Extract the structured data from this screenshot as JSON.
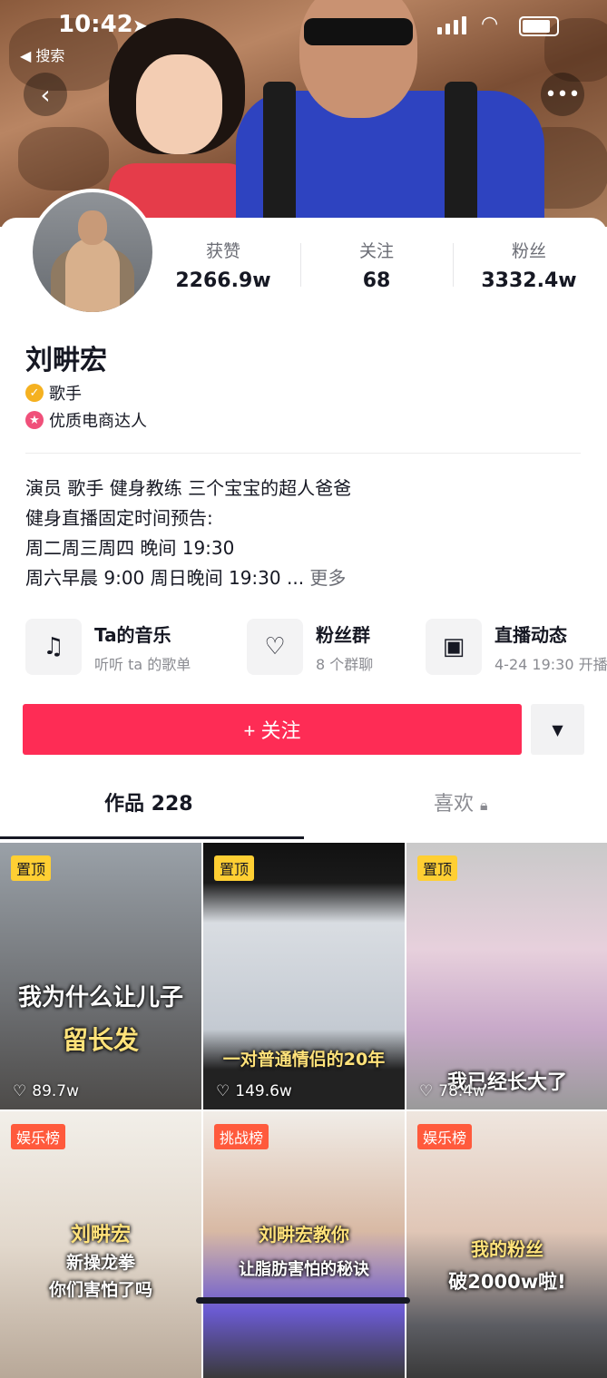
{
  "status_bar": {
    "time": "10:42",
    "back_app": "◀ 搜索"
  },
  "profile": {
    "name": "刘畊宏",
    "tags": [
      "歌手",
      "优质电商达人"
    ],
    "stats": [
      {
        "label": "获赞",
        "value": "2266.9w"
      },
      {
        "label": "关注",
        "value": "68"
      },
      {
        "label": "粉丝",
        "value": "3332.4w"
      }
    ],
    "bio": [
      "演员 歌手 健身教练 三个宝宝的超人爸爸",
      "健身直播固定时间预告:",
      "周二周三周四 晚间 19:30",
      "周六早晨 9:00 周日晚间 19:30 ..."
    ],
    "bio_more": "更多"
  },
  "services": [
    {
      "title": "Ta的音乐",
      "sub": "听听 ta 的歌单",
      "icon": "music-note-icon"
    },
    {
      "title": "粉丝群",
      "sub": "8 个群聊",
      "icon": "fan-group-icon"
    },
    {
      "title": "直播动态",
      "sub": "4-24 19:30 开播",
      "icon": "tv-icon"
    }
  ],
  "actions": {
    "follow": "+ 关注"
  },
  "tabs": {
    "works": "作品 228",
    "likes": "喜欢"
  },
  "videos": [
    {
      "badge": "置顶",
      "caption1": "我为什么让儿子",
      "caption2": "留长发",
      "likes": "89.7w"
    },
    {
      "badge": "置顶",
      "caption1": "一对普通情侣的20年",
      "likes": "149.6w"
    },
    {
      "badge": "置顶",
      "caption1": "我已经长大了",
      "likes": "78.4w"
    },
    {
      "badge": "娱乐榜",
      "caption1": "刘畊宏",
      "caption2": "新操龙拳",
      "caption3": "你们害怕了吗"
    },
    {
      "badge": "挑战榜",
      "caption1": "刘畊宏教你",
      "caption2": "让脂肪害怕的秘诀"
    },
    {
      "badge": "娱乐榜",
      "caption1": "我的粉丝",
      "caption2": "破2000w啦!"
    }
  ]
}
